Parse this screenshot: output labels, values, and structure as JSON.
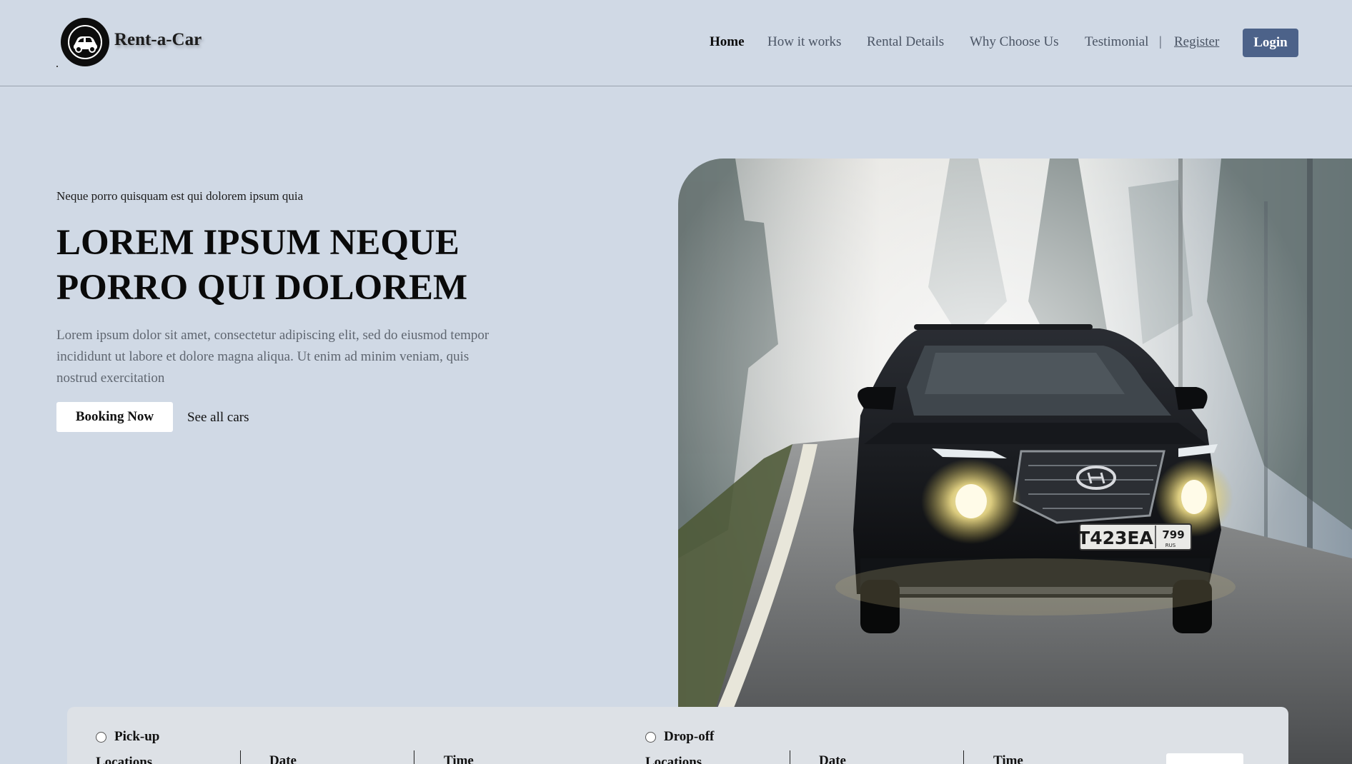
{
  "header": {
    "brand": "Rent-a-Car",
    "nav": [
      {
        "label": "Home",
        "active": true
      },
      {
        "label": "How it works",
        "active": false
      },
      {
        "label": "Rental Details",
        "active": false
      },
      {
        "label": "Why Choose Us",
        "active": false
      },
      {
        "label": "Testimonial",
        "active": false
      }
    ],
    "separator": "|",
    "register_label": "Register",
    "login_label": "Login",
    "logo_icon": "car-emblem-icon"
  },
  "hero": {
    "eyebrow": "Neque porro quisquam est qui dolorem ipsum quia",
    "title_line1": "LOREM IPSUM NEQUE",
    "title_line2": "PORRO QUI DOLOREM",
    "description": "Lorem ipsum dolor sit amet, consectetur adipiscing elit, sed do eiusmod tempor incididunt ut labore et dolore magna aliqua. Ut enim ad minim veniam, quis nostrud exercitation",
    "primary_button": "Booking Now",
    "secondary_link": "See all cars",
    "license_plate": "T423EA",
    "plate_region": "799",
    "plate_country": "RUS"
  },
  "booking": {
    "pickup": {
      "option": "Pick-up",
      "locations": "Locations",
      "date": "Date",
      "time": "Time"
    },
    "dropoff": {
      "option": "Drop-off",
      "locations": "Locations",
      "date": "Date",
      "time": "Time"
    }
  },
  "colors": {
    "page_background": "#d0d9e5",
    "accent": "#4c6289",
    "panel": "#dde1e6"
  }
}
